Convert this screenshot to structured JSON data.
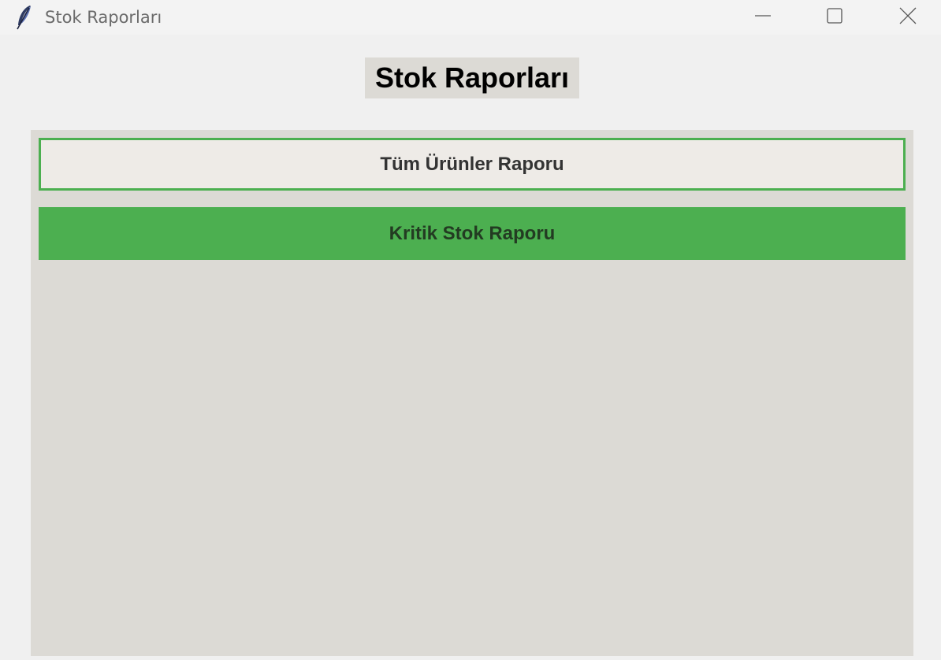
{
  "window": {
    "title": "Stok Raporları",
    "icon": "feather-icon",
    "controls": [
      "minimize-icon",
      "maximize-icon",
      "close-icon"
    ]
  },
  "page": {
    "heading": "Stok Raporları"
  },
  "buttons": {
    "all_products_label": "Tüm Ürünler Raporu",
    "critical_stock_label": "Kritik Stok Raporu"
  },
  "colors": {
    "accent": "#4caf50",
    "panel": "#dcdad5",
    "window_bg": "#f0f0f0"
  }
}
